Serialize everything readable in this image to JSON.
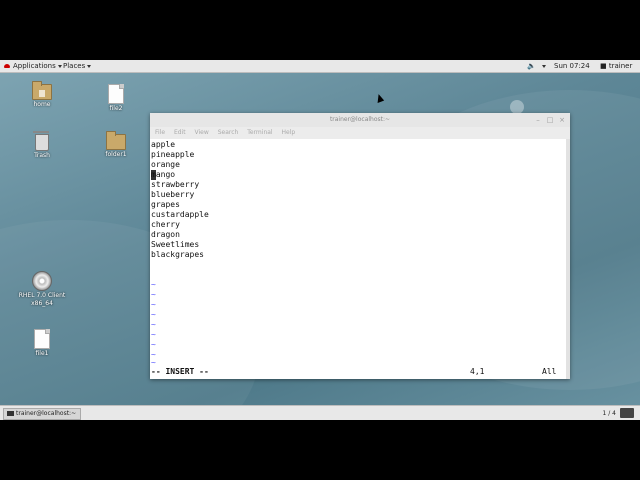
{
  "topbar": {
    "applications": "Applications",
    "places": "Places",
    "clock": "Sun 07:24",
    "user": "trainer"
  },
  "desktop": {
    "icons": [
      {
        "label": "home",
        "icon": "home-folder-icon"
      },
      {
        "label": "file2",
        "icon": "file-icon"
      },
      {
        "label": "Trash",
        "icon": "trash-icon"
      },
      {
        "label": "folder1",
        "icon": "folder-icon"
      },
      {
        "label": "RHEL 7.0 Client",
        "label2": "x86_64",
        "icon": "disc-icon"
      },
      {
        "label": "file1",
        "icon": "file-icon"
      }
    ]
  },
  "terminal": {
    "title": "trainer@localhost:~",
    "menu": [
      "File",
      "Edit",
      "View",
      "Search",
      "Terminal",
      "Help"
    ],
    "lines": [
      "apple",
      "pineapple",
      "orange",
      "mango",
      "strawberry",
      "blueberry",
      "grapes",
      "custardapple",
      "cherry",
      "dragon",
      "Sweetlimes",
      "blackgrapes"
    ],
    "tilde": "~",
    "mode": "-- INSERT --",
    "position": "4,1",
    "scroll": "All"
  },
  "bottombar": {
    "task": "trainer@localhost:~",
    "workspace": "1 / 4"
  },
  "colors": {
    "desktop": "#5e8797",
    "tilde": "#5050ff"
  }
}
